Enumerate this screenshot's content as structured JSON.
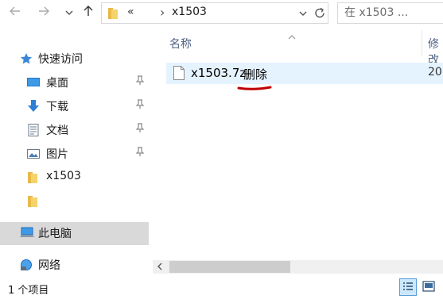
{
  "nav": {
    "back_icon": "back-arrow-icon",
    "forward_icon": "forward-arrow-icon",
    "recent_icon": "chevron-down-icon",
    "up_icon": "up-arrow-icon"
  },
  "address": {
    "overflow": "«",
    "separator": "›",
    "path_current": "x1503",
    "refresh_icon": "refresh-icon"
  },
  "search": {
    "placeholder": "在 x1503 ..."
  },
  "sidebar": {
    "quick_access": "快速访问",
    "items": [
      {
        "label": "桌面",
        "icon": "desktop-icon",
        "pinned": true
      },
      {
        "label": "下载",
        "icon": "download-icon",
        "pinned": true
      },
      {
        "label": "文档",
        "icon": "document-icon",
        "pinned": true
      },
      {
        "label": "图片",
        "icon": "pictures-icon",
        "pinned": true
      },
      {
        "label": "x1503",
        "icon": "folder-icon",
        "pinned": false
      },
      {
        "label": "",
        "icon": "folder-icon",
        "pinned": false
      }
    ],
    "this_pc": "此电脑",
    "network": "网络"
  },
  "content": {
    "col_name": "名称",
    "col_modified": "修改",
    "files": [
      {
        "name": "x1503.7z",
        "modified_partial": "20",
        "annotation": "删除"
      }
    ]
  },
  "status": {
    "item_count": "1 个项目"
  },
  "colors": {
    "selection": "#e5f3ff",
    "annotation_red": "#c00000"
  }
}
